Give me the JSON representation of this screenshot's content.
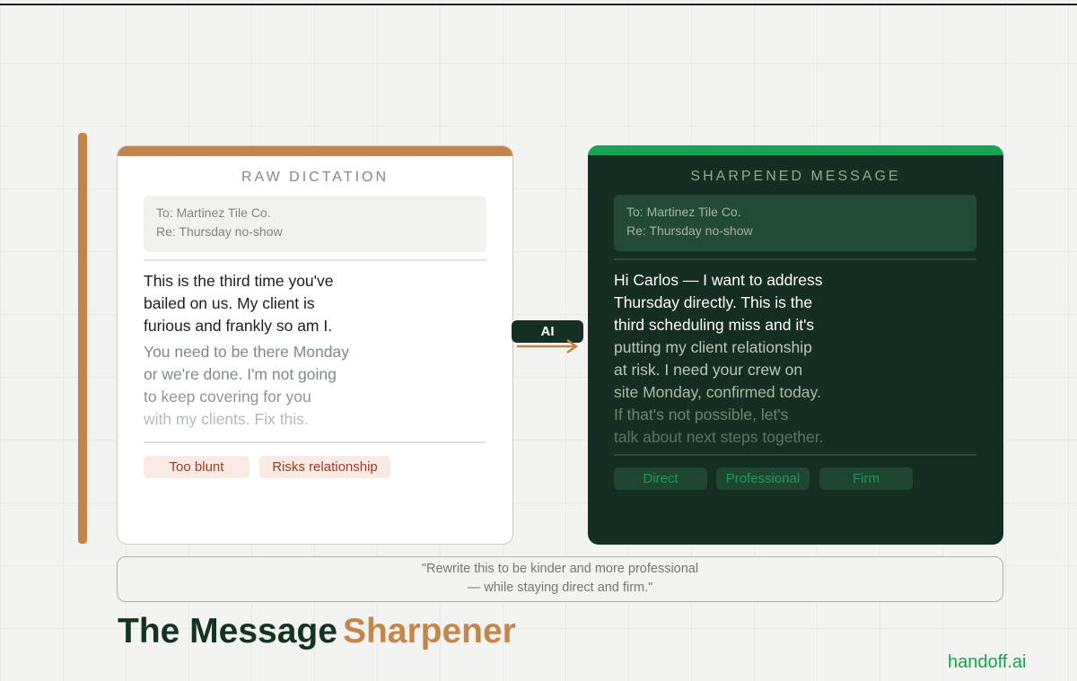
{
  "raw": {
    "title": "RAW DICTATION",
    "header_to": "To: Martinez Tile Co.",
    "header_re": "Re: Thursday no-show",
    "lines": [
      "This is the third time you've",
      "bailed on us. My client is",
      "furious and frankly so am I.",
      "You need to be there Monday",
      "or we're done. I'm not going",
      "to keep covering for you",
      "with my clients. Fix this."
    ],
    "tags": [
      "Too blunt",
      "Risks relationship"
    ]
  },
  "ai_label": "AI",
  "sharpened": {
    "title": "SHARPENED MESSAGE",
    "header_to": "To: Martinez Tile Co.",
    "header_re": "Re: Thursday no-show",
    "lines": [
      "Hi Carlos — I want to address",
      "Thursday directly. This is the",
      "third scheduling miss and it's",
      "putting my client relationship",
      "at risk. I need your crew on",
      "site Monday, confirmed today.",
      "If that's not possible, let's",
      "talk about next steps together."
    ],
    "tags": [
      "Direct",
      "Professional",
      "Firm"
    ]
  },
  "prompt": {
    "line1": "\"Rewrite this to be kinder and more professional",
    "line2": "— while staying direct and firm.\""
  },
  "brand": {
    "title_part1": "The Message",
    "title_part2": "Sharpener",
    "site": "handoff.ai"
  },
  "colors": {
    "accent_orange": "#c4834b",
    "accent_green": "#16a455",
    "dark_panel": "#142e22"
  }
}
